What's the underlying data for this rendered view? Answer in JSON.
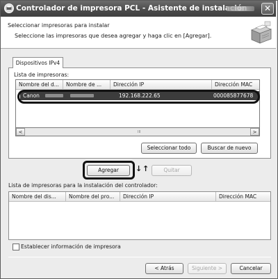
{
  "window": {
    "title": "Controlador de impresora PCL - Asistente de instalación",
    "close_glyph": "✕",
    "icon": "printer-wizard-icon"
  },
  "header": {
    "title": "Seleccionar impresoras para instalar",
    "description": "Seleccione las impresoras que desea agregar y haga clic en [Agregar].",
    "graphic": "printer-graphic-icon"
  },
  "tab": {
    "label": "Dispositivos IPv4"
  },
  "printer_list": {
    "label": "Lista de impresoras:",
    "columns": [
      "Nombre del d...",
      "Nombre de ...",
      "Dirección IP",
      "Dirección MAC"
    ],
    "selected_row": {
      "name": "Canon",
      "ip": "192.168.222.65",
      "mac": "000085877678"
    },
    "scroll_left": "<",
    "scroll_right": ">",
    "scroll_grip": "III"
  },
  "buttons": {
    "select_all": "Seleccionar todo",
    "search_again": "Buscar de nuevo",
    "add": "Agregar",
    "remove": "Quitar",
    "back": "< Atrás",
    "next": "Siguiente >",
    "cancel": "Cancelar"
  },
  "arrows": {
    "down": "↓",
    "up": "↑"
  },
  "install_list": {
    "label": "Lista de impresoras para la instalación del controlador:",
    "columns": [
      "Nombre del dis...",
      "Nombre del pro...",
      "Dirección IP",
      "Dirección MAC"
    ]
  },
  "checkbox": {
    "label": "Establecer información de impresora"
  },
  "colors": {
    "title_bar": "#4a4a4a",
    "selection": "#3c3c3c",
    "highlight_outline": "#111111"
  }
}
